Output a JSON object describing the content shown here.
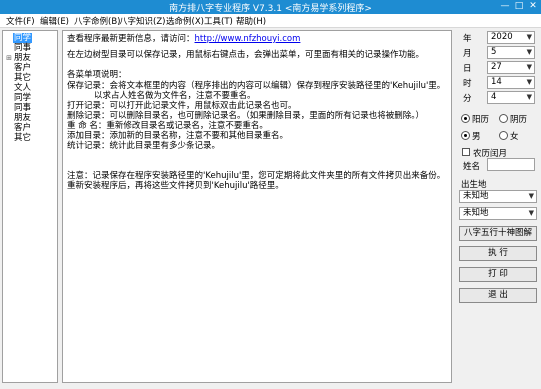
{
  "window": {
    "title": "南方排八字专业程序 V7.3.1   <南方易学系列程序>",
    "minimize": "—",
    "maximize": "□",
    "close": "✕"
  },
  "menu": [
    "文件(F)",
    "编辑(E)",
    "八字命例(B)",
    "八字知识(Z)",
    "选命例(X)",
    "工具(T)",
    "帮助(H)"
  ],
  "tree": [
    {
      "label": "同学",
      "expander": "",
      "selected": true
    },
    {
      "label": "同事",
      "expander": ""
    },
    {
      "label": "朋友",
      "expander": "⊞"
    },
    {
      "label": "客户",
      "expander": ""
    },
    {
      "label": "其它",
      "expander": ""
    },
    {
      "label": "文人",
      "expander": ""
    },
    {
      "label": "同学",
      "expander": ""
    },
    {
      "label": "同事",
      "expander": ""
    },
    {
      "label": "朋友",
      "expander": ""
    },
    {
      "label": "客户",
      "expander": ""
    },
    {
      "label": "其它",
      "expander": ""
    }
  ],
  "content": {
    "line1_text": "查看程序最新更新信息，请访问：",
    "line1_link": "http://www.nfzhouyi.com",
    "line2": "在左边树型目录可以保存记录，用鼠标右键点击，会弹出菜单，可里面有相关的记录操作功能。",
    "line3": "各菜单项说明：",
    "line4": "保存记录：会将文本框里的内容（程序排出的内容可以编辑）保存到程序安装路径里的'Kehujilu'里。",
    "line5": "          以求占人姓名做为文件名，注意不要重名。",
    "line6": "打开记录：可以打开此记录文件，用鼠标双击此记录名也可。",
    "line7": "删除记录：可以删除目录名，也可删除记录名。（如果删除目录，里面的所有记录也将被删除。）",
    "line8": "重 命 名：重新修改目录名或记录名，注意不要重名。",
    "line9": "添加目录：添加新的目录名称，注意不要和其他目录重名。",
    "line10": "统计记录：统计此目录里有多少条记录。",
    "line11": "注意：记录保存在程序安装路径里的'Kehujilu'里，您可定期将此文件夹里的所有文件拷贝出来备份。",
    "line12": "重新安装程序后，再将这些文件拷贝到'Kehujilu'路径里。"
  },
  "form": {
    "year": {
      "label": "年",
      "value": "2020"
    },
    "month": {
      "label": "月",
      "value": "5"
    },
    "day": {
      "label": "日",
      "value": "27"
    },
    "hour": {
      "label": "时",
      "value": "14"
    },
    "minute": {
      "label": "分",
      "value": "4"
    },
    "calendar": {
      "solar": "阳历",
      "lunar": "阴历",
      "selected": "solar"
    },
    "gender": {
      "male": "男",
      "female": "女",
      "selected": "male"
    },
    "leap_month": {
      "label": "农历闰月",
      "checked": false
    },
    "name": {
      "label": "姓名",
      "value": ""
    },
    "birthplace": {
      "label": "出生地",
      "province": "未知地",
      "city": "未知地"
    }
  },
  "buttons": {
    "wuxing": "八字五行十神图解",
    "execute": "执 行",
    "print": "打 印",
    "exit": "退 出"
  }
}
